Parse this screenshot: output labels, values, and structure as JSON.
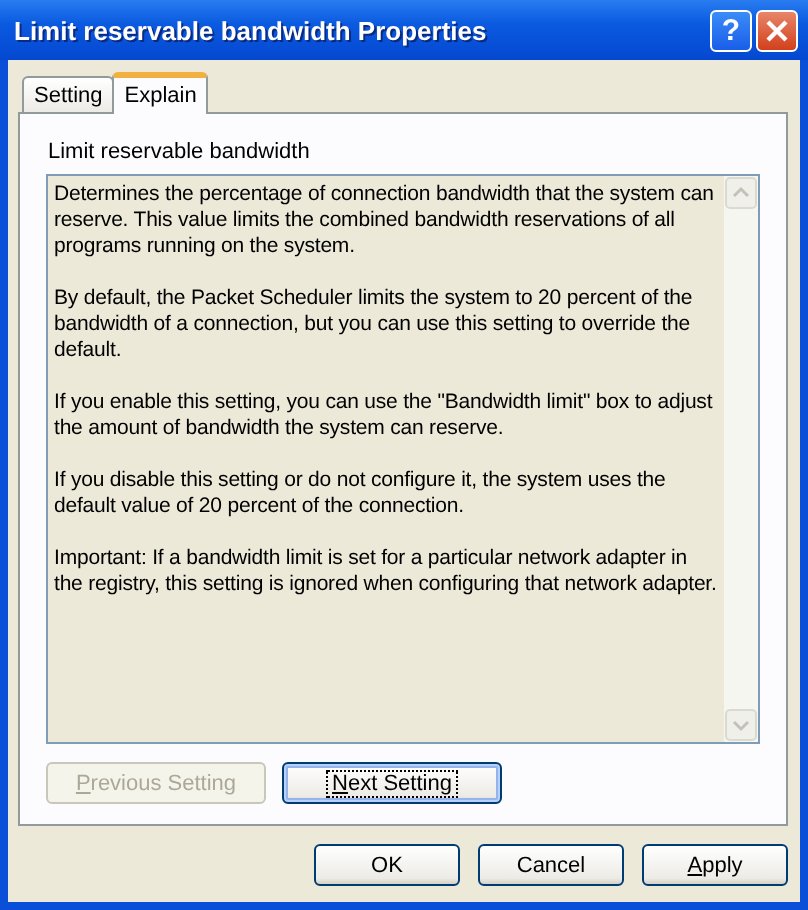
{
  "window": {
    "title": "Limit reservable bandwidth Properties",
    "help_button": "?"
  },
  "tabs": [
    {
      "label": "Setting",
      "selected": false
    },
    {
      "label": "Explain",
      "selected": true
    }
  ],
  "heading": "Limit reservable bandwidth",
  "explain_text": [
    "Determines the percentage of connection bandwidth that the system can reserve. This value limits the combined bandwidth reservations of all programs running on the system.",
    "By default, the Packet Scheduler limits the system to 20 percent of the bandwidth of a connection, but you can use this setting to override the default.",
    "If you enable this setting, you can use the \"Bandwidth limit\" box to adjust the amount of bandwidth the system can reserve.",
    "If you disable this setting or do not configure it, the system uses the default value of 20 percent of the connection.",
    "Important: If a bandwidth limit is set for a particular network adapter in the registry, this setting is ignored when configuring that network adapter."
  ],
  "nav_buttons": [
    {
      "label": "Previous Setting",
      "disabled": true,
      "focused": false,
      "underline_first": true
    },
    {
      "label": "Next Setting",
      "disabled": false,
      "focused": true,
      "underline_first": true
    }
  ],
  "buttons": [
    {
      "label": "OK",
      "underline_first": false
    },
    {
      "label": "Cancel",
      "underline_first": false
    },
    {
      "label": "Apply",
      "underline_first": true
    }
  ]
}
